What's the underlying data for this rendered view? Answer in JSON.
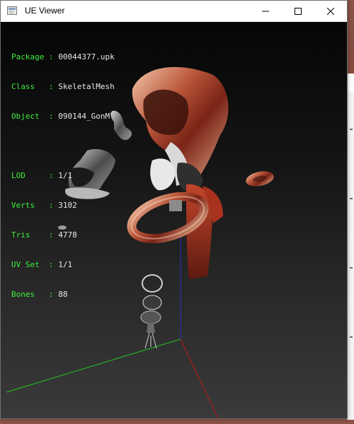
{
  "window": {
    "title": "UE Viewer",
    "buttons": {
      "minimize": "minimize",
      "maximize": "maximize",
      "close": "close"
    }
  },
  "info": {
    "rows1": [
      {
        "key": "Package",
        "value": "00044377.upk"
      },
      {
        "key": "Class  ",
        "value": "SkeletalMesh"
      },
      {
        "key": "Object ",
        "value": "090144_GonM"
      }
    ],
    "rows2": [
      {
        "key": "LOD    ",
        "value": "1/1"
      },
      {
        "key": "Verts  ",
        "value": "3102"
      },
      {
        "key": "Tris   ",
        "value": "4778"
      },
      {
        "key": "UV Set ",
        "value": "1/1"
      },
      {
        "key": "Bones  ",
        "value": "88"
      }
    ]
  },
  "colors": {
    "label_green": "#3cf03c",
    "value_white": "#e8e8e8",
    "axis_x": "#c01818",
    "axis_y": "#1fc81f",
    "axis_z": "#2a2ad0"
  }
}
